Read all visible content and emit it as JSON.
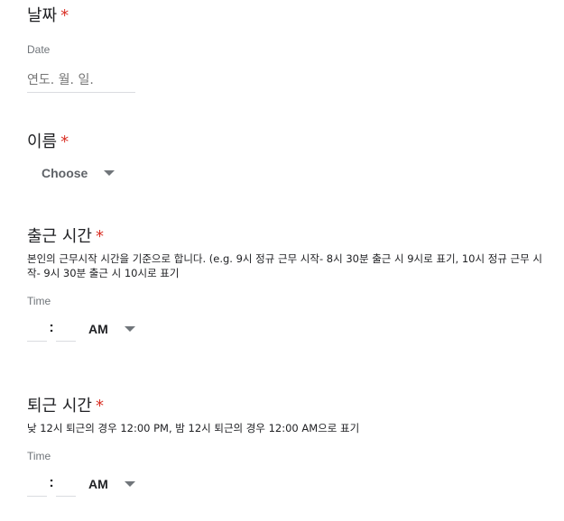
{
  "q_date": {
    "title": "날짜",
    "required_mark": "*",
    "sub_label": "Date",
    "placeholder": "연도. 월. 일."
  },
  "q_name": {
    "title": "이름",
    "required_mark": "*",
    "select_value": "Choose"
  },
  "q_start": {
    "title": "출근 시간",
    "required_mark": "*",
    "description": "본인의 근무시작 시간을 기준으로 합니다. (e.g. 9시 정규 근무 시작- 8시 30분 출근 시 9시로 표기, 10시 정규 근무 시작- 9시 30분 출근 시 10시로 표기",
    "sub_label": "Time",
    "colon": ":",
    "ampm": "AM"
  },
  "q_end": {
    "title": "퇴근 시간",
    "required_mark": "*",
    "description": "낮 12시 퇴근의 경우 12:00 PM, 밤 12시 퇴근의 경우 12:00 AM으로 표기",
    "sub_label": "Time",
    "colon": ":",
    "ampm": "AM"
  },
  "colors": {
    "required": "#d93025",
    "text": "#202124",
    "muted": "#70757a",
    "underline": "#dadce0"
  },
  "icons": {
    "dropdown": "chevron-down-icon"
  }
}
